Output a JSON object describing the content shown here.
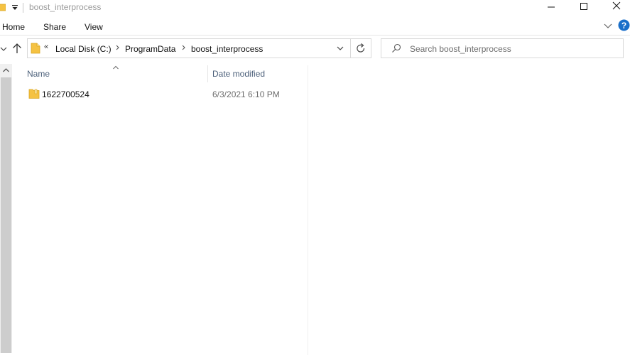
{
  "window": {
    "title": "boost_interprocess",
    "minimize_icon": "minimize-icon",
    "maximize_icon": "maximize-icon",
    "close_icon": "close-icon"
  },
  "ribbon": {
    "tabs": [
      {
        "label": "Home"
      },
      {
        "label": "Share"
      },
      {
        "label": "View"
      }
    ]
  },
  "address": {
    "overflow": "«",
    "crumbs": [
      {
        "label": "Local Disk (C:)"
      },
      {
        "label": "ProgramData"
      },
      {
        "label": "boost_interprocess"
      }
    ]
  },
  "search": {
    "placeholder": "Search boost_interprocess"
  },
  "columns": {
    "name": "Name",
    "date_modified": "Date modified"
  },
  "files": [
    {
      "name": "1622700524",
      "date_modified": "6/3/2021 6:10 PM",
      "icon": "folder-icon"
    }
  ],
  "colors": {
    "header_text": "#4c607a",
    "folder": "#f5c242",
    "help": "#1a6fc9"
  }
}
